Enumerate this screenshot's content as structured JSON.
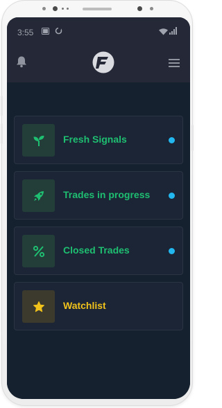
{
  "status_bar": {
    "time": "3:55",
    "icons": [
      "image-icon",
      "sync-icon",
      "wifi-icon",
      "signal-icon"
    ]
  },
  "app_bar": {
    "left_icon": "bell-icon",
    "logo_letter": "F",
    "right_icon": "hamburger-menu-icon"
  },
  "colors": {
    "accent_green": "#1fbf72",
    "accent_yellow": "#f1c21b",
    "indicator_blue": "#23b7f0"
  },
  "menu": [
    {
      "id": "fresh-signals",
      "label": "Fresh Signals",
      "icon": "sprout-icon",
      "has_indicator": true
    },
    {
      "id": "trades-in-progress",
      "label": "Trades in progress",
      "icon": "rocket-icon",
      "has_indicator": true
    },
    {
      "id": "closed-trades",
      "label": "Closed Trades",
      "icon": "percent-icon",
      "has_indicator": true
    },
    {
      "id": "watchlist",
      "label": "Watchlist",
      "icon": "star-icon",
      "has_indicator": false
    }
  ]
}
